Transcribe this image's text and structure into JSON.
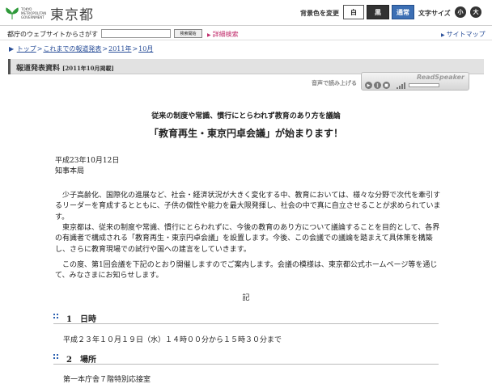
{
  "header": {
    "logo_small": "TOKYO METROPOLITAN GOVERNMENT",
    "logo_big": "東京都",
    "bg_color_label": "背景色を変更",
    "bg_white": "白",
    "bg_black": "黒",
    "bg_normal": "通常",
    "font_size_label": "文字サイズ",
    "font_small": "小",
    "font_large": "大"
  },
  "search": {
    "label": "都庁のウェブサイトからさがす",
    "value": "",
    "button": "検索開始",
    "advanced": "詳細検索",
    "sitemap": "サイトマップ"
  },
  "breadcrumb": {
    "items": [
      "トップ",
      "これまでの報道発表",
      "2011年",
      "10月"
    ]
  },
  "title_band": {
    "title": "報道発表資料",
    "date": "[2011年10月掲載]"
  },
  "readspeaker": {
    "label": "音声で読み上げる",
    "brand": "ReadSpeaker"
  },
  "article": {
    "subtitle": "従来の制度や常識、慣行にとらわれず教育のあり方を議論",
    "headline": "「教育再生・東京円卓会議」が始まります！",
    "date": "平成23年10月12日",
    "department": "知事本局",
    "para1": "少子高齢化、国際化の進展など、社会・経済状況が大きく変化する中、教育においては、様々な分野で次代を牽引するリーダーを育成するとともに、子供の個性や能力を最大限発揮し、社会の中で真に自立させることが求められています。",
    "para2": "東京都は、従来の制度や常識、慣行にとらわれずに、今後の教育のあり方について議論することを目的として、各界の有識者で構成される「教育再生・東京円卓会議」を設置します。今後、この会議での議論を踏まえて具体策を構築し、さらに教育現場での試行や国への建言をしていきます。",
    "para3": "この度、第1回会議を下記のとおり開催しますのでご案内します。会議の模様は、東京都公式ホームページ等を通じて、みなさまにお知らせします。",
    "ki": "記",
    "section1_title": "1　日時",
    "section1_text": "平成２３年１０月１９日（水）１４時００分から１５時３０分まで",
    "section2_title": "2　場所",
    "section2_text": "第一本庁舎７階特別応接室"
  }
}
